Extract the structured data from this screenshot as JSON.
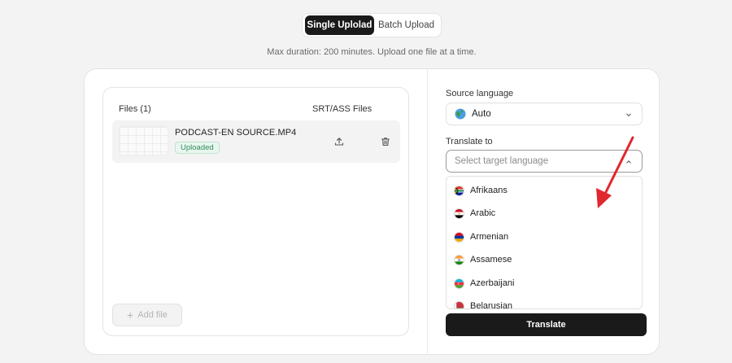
{
  "mode_toggle": {
    "single": "Single Uplolad",
    "batch": "Batch Upload"
  },
  "subtitle": "Max duration: 200 minutes. Upload one file at a time.",
  "files_panel": {
    "files_header": "Files (1)",
    "srt_header": "SRT/ASS Files",
    "files": [
      {
        "name": "PODCAST-EN SOURCE.MP4",
        "status": "Uploaded"
      }
    ],
    "add_file_label": "Add file"
  },
  "source_language": {
    "label": "Source language",
    "value": "Auto",
    "icon": "globe-icon"
  },
  "translate_to": {
    "label": "Translate to",
    "placeholder": "Select target language"
  },
  "languages": [
    "Afrikaans",
    "Arabic",
    "Armenian",
    "Assamese",
    "Azerbaijani",
    "Belarusian"
  ],
  "translate_button": "Translate",
  "colors": {
    "accent_dark": "#1a1a1a",
    "uploaded_green": "#2f8d5c",
    "annotation_red": "#e0282e"
  }
}
